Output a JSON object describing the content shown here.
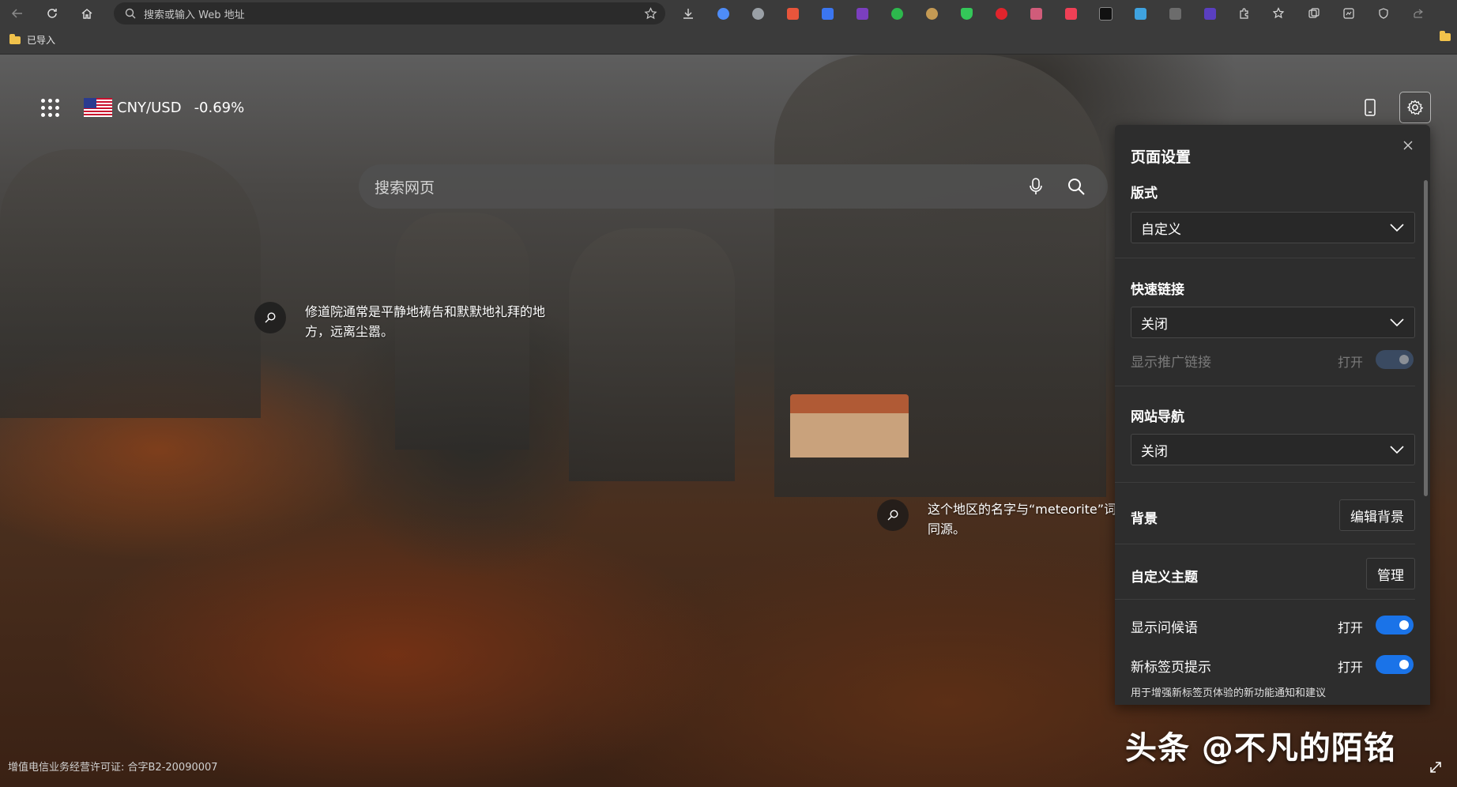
{
  "browser": {
    "address_placeholder": "搜索或输入 Web 地址",
    "bookmark_folder": "已导入"
  },
  "extensions": [
    {
      "icon": "copilot-icon",
      "color": "#4e8cf7"
    },
    {
      "icon": "atom-icon",
      "color": "#9aa0a6"
    },
    {
      "icon": "grid-ext-icon",
      "color": "#e8553b"
    },
    {
      "icon": "kingsoft-icon",
      "color": "#3b76f0"
    },
    {
      "icon": "onenote-icon",
      "color": "#7b3fbf"
    },
    {
      "icon": "y-ext-icon",
      "color": "#2db84d"
    },
    {
      "icon": "owl-ext-icon",
      "color": "#c49a54"
    },
    {
      "icon": "shield-ext-icon",
      "color": "#34c759"
    },
    {
      "icon": "red-ext-icon",
      "color": "#e0242c"
    },
    {
      "icon": "gamepad-ext-icon",
      "color": "#d05c7a"
    },
    {
      "icon": "pocket-ext-icon",
      "color": "#ef4056"
    },
    {
      "icon": "l-ext-icon",
      "color": "#111111"
    },
    {
      "icon": "image-ext-icon",
      "color": "#3fa3e0"
    },
    {
      "icon": "doc-ext-icon",
      "color": "#6c6c6c"
    },
    {
      "icon": "ia-ext-icon",
      "color": "#5a3fc0"
    }
  ],
  "widgets": {
    "currency_pair": "CNY/USD",
    "currency_change": "-0.69%"
  },
  "search": {
    "placeholder": "搜索网页"
  },
  "hotspots": [
    {
      "text": "修道院通常是平静地祷告和默默地礼拜的地方，远离尘嚣。"
    },
    {
      "text": "这个地区的名字与“meteorite”词同源。"
    }
  ],
  "settings": {
    "title": "页面设置",
    "layout_label": "版式",
    "layout_value": "自定义",
    "quicklinks_label": "快速链接",
    "quicklinks_value": "关闭",
    "promo_label": "显示推广链接",
    "promo_state": "打开",
    "nav_label": "网站导航",
    "nav_value": "关闭",
    "background_label": "背景",
    "background_button": "编辑背景",
    "theme_label": "自定义主题",
    "theme_button": "管理",
    "greeting_label": "显示问候语",
    "greeting_state": "打开",
    "tips_label": "新标签页提示",
    "tips_state": "打开",
    "tips_note": "用于增强新标签页体验的新功能通知和建议"
  },
  "footer": {
    "license": "增值电信业务经营许可证: 合字B2-20090007",
    "watermark": "头条 @不凡的陌铭"
  }
}
